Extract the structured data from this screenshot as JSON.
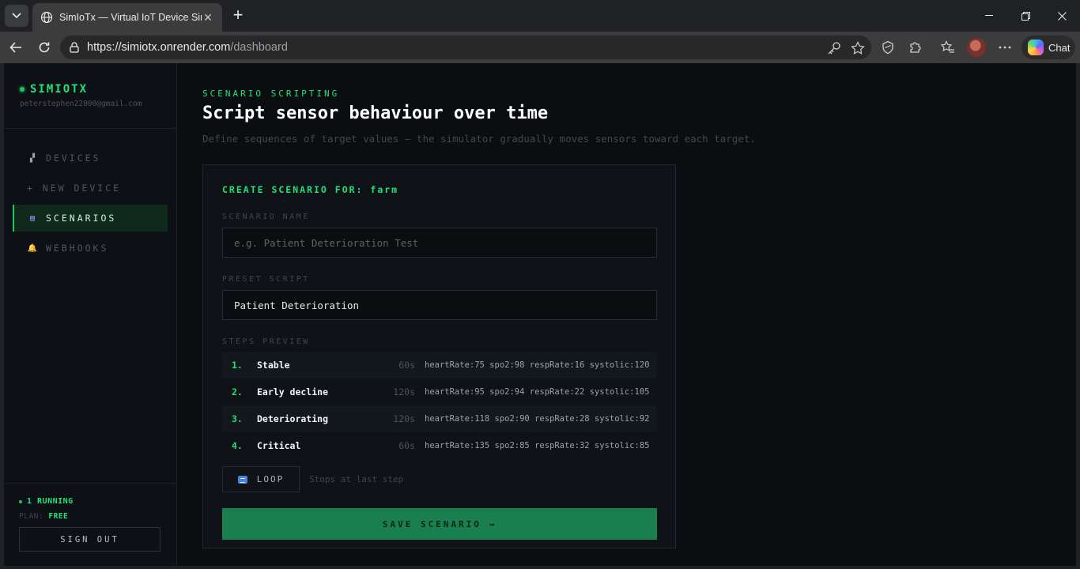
{
  "browser": {
    "tab_title": "SimIoTx — Virtual IoT Device Simu",
    "url_host": "https://simiotx.onrender.com",
    "url_path": "/dashboard",
    "chat_label": "Chat"
  },
  "sidebar": {
    "brand": "SIMIOTX",
    "email": "peterstephen22000@gmail.com",
    "items": [
      {
        "label": "DEVICES",
        "icon": "device-icon",
        "glyph": "▞"
      },
      {
        "label": "+ NEW DEVICE",
        "icon": "",
        "glyph": ""
      },
      {
        "label": "SCENARIOS",
        "icon": "clapper-icon",
        "glyph": "▤"
      },
      {
        "label": "WEBHOOKS",
        "icon": "bell-icon",
        "glyph": "🔔"
      }
    ],
    "running": "1 RUNNING",
    "plan_label": "PLAN:",
    "plan_value": "FREE",
    "sign_out": "SIGN OUT"
  },
  "main": {
    "eyebrow": "SCENARIO SCRIPTING",
    "heading": "Script sensor behaviour over time",
    "subtitle": "Define sequences of target values — the simulator gradually moves sensors toward each target.",
    "card": {
      "title": "CREATE SCENARIO FOR: farm",
      "name_label": "SCENARIO NAME",
      "name_placeholder": "e.g. Patient Deterioration Test",
      "preset_label": "PRESET SCRIPT",
      "preset_value": "Patient Deterioration",
      "steps_label": "STEPS PREVIEW",
      "steps": [
        {
          "num": "1.",
          "name": "Stable",
          "duration": "60s",
          "values": "heartRate:75 spo2:98 respRate:16 systolic:120"
        },
        {
          "num": "2.",
          "name": "Early decline",
          "duration": "120s",
          "values": "heartRate:95 spo2:94 respRate:22 systolic:105"
        },
        {
          "num": "3.",
          "name": "Deteriorating",
          "duration": "120s",
          "values": "heartRate:118 spo2:90 respRate:28 systolic:92"
        },
        {
          "num": "4.",
          "name": "Critical",
          "duration": "60s",
          "values": "heartRate:135 spo2:85 respRate:32 systolic:85"
        }
      ],
      "loop_label": "LOOP",
      "loop_note": "Stops at last step",
      "save_label": "SAVE SCENARIO →"
    }
  },
  "colors": {
    "accent": "#22e07a",
    "background": "#0b0e11",
    "save_button": "#1a7f4e"
  }
}
